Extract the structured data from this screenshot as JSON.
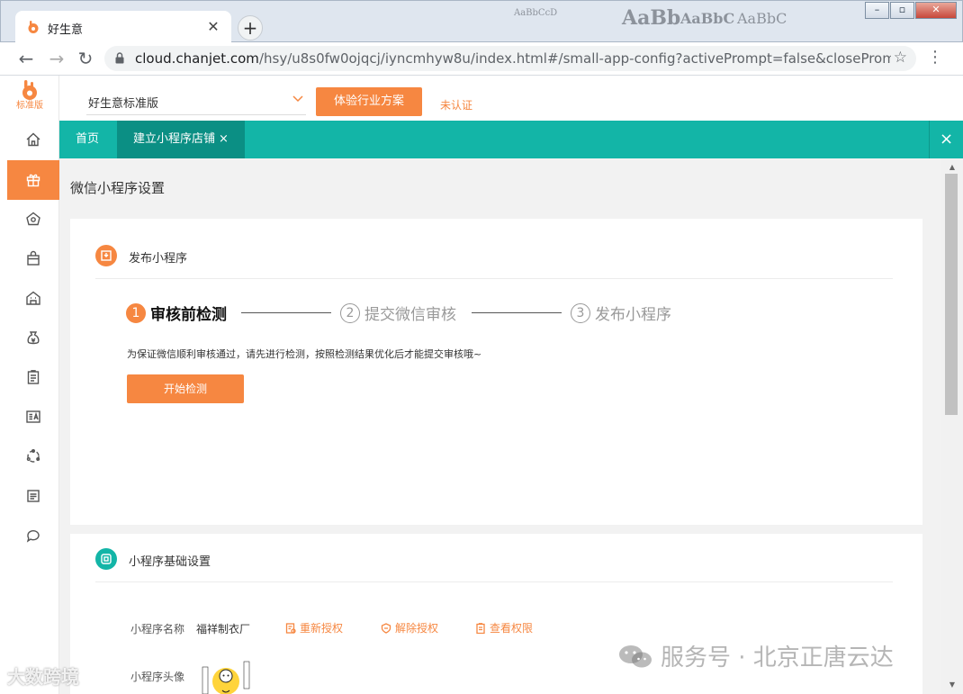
{
  "browser": {
    "tab_title": "好生意",
    "url_host": "cloud.chanjet.com",
    "url_path": "/hsy/u8s0fw0ojqcj/iyncmhyw8u/index.html#/small-app-config?activePrompt=false&closePrompt=false...",
    "titlebar_decor": [
      "AaBbCcD",
      "AaBb",
      "AaBbC",
      "AaBbC"
    ]
  },
  "app": {
    "brand_text": "标准版",
    "edition_select": "好生意标准版",
    "try_button": "体验行业方案",
    "auth_status": "未认证",
    "tabs": [
      {
        "label": "首页"
      },
      {
        "label": "建立小程序店铺",
        "close": "×"
      }
    ],
    "tabs_close": "×"
  },
  "page": {
    "title": "微信小程序设置",
    "publish_card": {
      "title": "发布小程序",
      "steps": [
        {
          "num": "1",
          "label": "审核前检测"
        },
        {
          "num": "2",
          "label": "提交微信审核"
        },
        {
          "num": "3",
          "label": "发布小程序"
        }
      ],
      "hint": "为保证微信顺利审核通过，请先进行检测，按照检测结果优化后才能提交审核哦~",
      "start_button": "开始检测"
    },
    "basic_card": {
      "title": "小程序基础设置",
      "name_label": "小程序名称",
      "name_value": "福祥制衣厂",
      "reauthorize": "重新授权",
      "unauthorize": "解除授权",
      "view_permissions": "查看权限",
      "avatar_label": "小程序头像"
    }
  },
  "watermark": {
    "right": "服务号 · 北京正唐云达",
    "left": "大数跨境"
  },
  "colors": {
    "accent": "#f68741",
    "teal": "#13b5a7",
    "teal_dark": "#0b8f84"
  }
}
